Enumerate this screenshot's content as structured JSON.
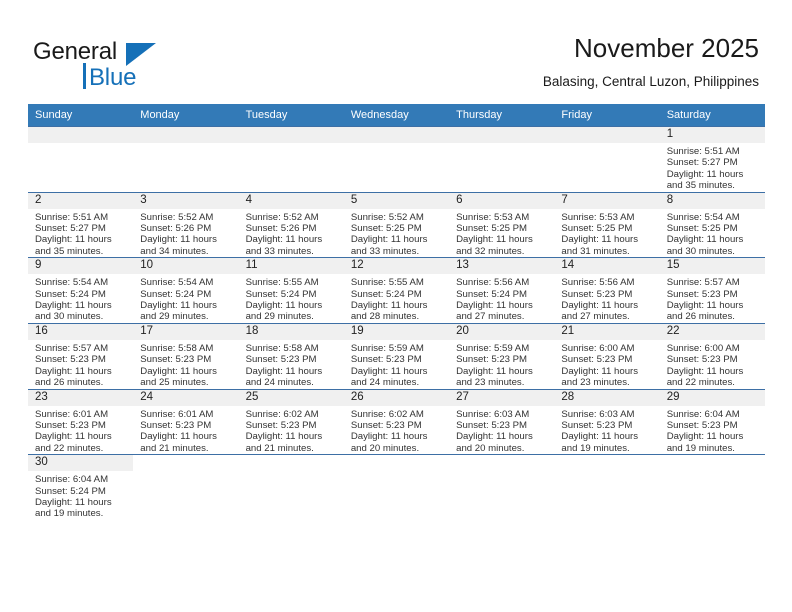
{
  "brand": {
    "name_top": "General",
    "name_bottom": "Blue",
    "accent_color": "#1570b8"
  },
  "header": {
    "title": "November 2025",
    "subtitle": "Balasing, Central Luzon, Philippines"
  },
  "calendar": {
    "header_color": "#337ab7",
    "daynum_band_color": "#f0f0f0",
    "row_border_color": "#3d6fa5",
    "weekdays": [
      "Sunday",
      "Monday",
      "Tuesday",
      "Wednesday",
      "Thursday",
      "Friday",
      "Saturday"
    ],
    "weeks": [
      [
        {
          "day": "",
          "sunrise": "",
          "sunset": "",
          "daylight": "",
          "empty": true
        },
        {
          "day": "",
          "sunrise": "",
          "sunset": "",
          "daylight": "",
          "empty": true
        },
        {
          "day": "",
          "sunrise": "",
          "sunset": "",
          "daylight": "",
          "empty": true
        },
        {
          "day": "",
          "sunrise": "",
          "sunset": "",
          "daylight": "",
          "empty": true
        },
        {
          "day": "",
          "sunrise": "",
          "sunset": "",
          "daylight": "",
          "empty": true
        },
        {
          "day": "",
          "sunrise": "",
          "sunset": "",
          "daylight": "",
          "empty": true
        },
        {
          "day": "1",
          "sunrise": "Sunrise: 5:51 AM",
          "sunset": "Sunset: 5:27 PM",
          "daylight": "Daylight: 11 hours and 35 minutes."
        }
      ],
      [
        {
          "day": "2",
          "sunrise": "Sunrise: 5:51 AM",
          "sunset": "Sunset: 5:27 PM",
          "daylight": "Daylight: 11 hours and 35 minutes."
        },
        {
          "day": "3",
          "sunrise": "Sunrise: 5:52 AM",
          "sunset": "Sunset: 5:26 PM",
          "daylight": "Daylight: 11 hours and 34 minutes."
        },
        {
          "day": "4",
          "sunrise": "Sunrise: 5:52 AM",
          "sunset": "Sunset: 5:26 PM",
          "daylight": "Daylight: 11 hours and 33 minutes."
        },
        {
          "day": "5",
          "sunrise": "Sunrise: 5:52 AM",
          "sunset": "Sunset: 5:25 PM",
          "daylight": "Daylight: 11 hours and 33 minutes."
        },
        {
          "day": "6",
          "sunrise": "Sunrise: 5:53 AM",
          "sunset": "Sunset: 5:25 PM",
          "daylight": "Daylight: 11 hours and 32 minutes."
        },
        {
          "day": "7",
          "sunrise": "Sunrise: 5:53 AM",
          "sunset": "Sunset: 5:25 PM",
          "daylight": "Daylight: 11 hours and 31 minutes."
        },
        {
          "day": "8",
          "sunrise": "Sunrise: 5:54 AM",
          "sunset": "Sunset: 5:25 PM",
          "daylight": "Daylight: 11 hours and 30 minutes."
        }
      ],
      [
        {
          "day": "9",
          "sunrise": "Sunrise: 5:54 AM",
          "sunset": "Sunset: 5:24 PM",
          "daylight": "Daylight: 11 hours and 30 minutes."
        },
        {
          "day": "10",
          "sunrise": "Sunrise: 5:54 AM",
          "sunset": "Sunset: 5:24 PM",
          "daylight": "Daylight: 11 hours and 29 minutes."
        },
        {
          "day": "11",
          "sunrise": "Sunrise: 5:55 AM",
          "sunset": "Sunset: 5:24 PM",
          "daylight": "Daylight: 11 hours and 29 minutes."
        },
        {
          "day": "12",
          "sunrise": "Sunrise: 5:55 AM",
          "sunset": "Sunset: 5:24 PM",
          "daylight": "Daylight: 11 hours and 28 minutes."
        },
        {
          "day": "13",
          "sunrise": "Sunrise: 5:56 AM",
          "sunset": "Sunset: 5:24 PM",
          "daylight": "Daylight: 11 hours and 27 minutes."
        },
        {
          "day": "14",
          "sunrise": "Sunrise: 5:56 AM",
          "sunset": "Sunset: 5:23 PM",
          "daylight": "Daylight: 11 hours and 27 minutes."
        },
        {
          "day": "15",
          "sunrise": "Sunrise: 5:57 AM",
          "sunset": "Sunset: 5:23 PM",
          "daylight": "Daylight: 11 hours and 26 minutes."
        }
      ],
      [
        {
          "day": "16",
          "sunrise": "Sunrise: 5:57 AM",
          "sunset": "Sunset: 5:23 PM",
          "daylight": "Daylight: 11 hours and 26 minutes."
        },
        {
          "day": "17",
          "sunrise": "Sunrise: 5:58 AM",
          "sunset": "Sunset: 5:23 PM",
          "daylight": "Daylight: 11 hours and 25 minutes."
        },
        {
          "day": "18",
          "sunrise": "Sunrise: 5:58 AM",
          "sunset": "Sunset: 5:23 PM",
          "daylight": "Daylight: 11 hours and 24 minutes."
        },
        {
          "day": "19",
          "sunrise": "Sunrise: 5:59 AM",
          "sunset": "Sunset: 5:23 PM",
          "daylight": "Daylight: 11 hours and 24 minutes."
        },
        {
          "day": "20",
          "sunrise": "Sunrise: 5:59 AM",
          "sunset": "Sunset: 5:23 PM",
          "daylight": "Daylight: 11 hours and 23 minutes."
        },
        {
          "day": "21",
          "sunrise": "Sunrise: 6:00 AM",
          "sunset": "Sunset: 5:23 PM",
          "daylight": "Daylight: 11 hours and 23 minutes."
        },
        {
          "day": "22",
          "sunrise": "Sunrise: 6:00 AM",
          "sunset": "Sunset: 5:23 PM",
          "daylight": "Daylight: 11 hours and 22 minutes."
        }
      ],
      [
        {
          "day": "23",
          "sunrise": "Sunrise: 6:01 AM",
          "sunset": "Sunset: 5:23 PM",
          "daylight": "Daylight: 11 hours and 22 minutes."
        },
        {
          "day": "24",
          "sunrise": "Sunrise: 6:01 AM",
          "sunset": "Sunset: 5:23 PM",
          "daylight": "Daylight: 11 hours and 21 minutes."
        },
        {
          "day": "25",
          "sunrise": "Sunrise: 6:02 AM",
          "sunset": "Sunset: 5:23 PM",
          "daylight": "Daylight: 11 hours and 21 minutes."
        },
        {
          "day": "26",
          "sunrise": "Sunrise: 6:02 AM",
          "sunset": "Sunset: 5:23 PM",
          "daylight": "Daylight: 11 hours and 20 minutes."
        },
        {
          "day": "27",
          "sunrise": "Sunrise: 6:03 AM",
          "sunset": "Sunset: 5:23 PM",
          "daylight": "Daylight: 11 hours and 20 minutes."
        },
        {
          "day": "28",
          "sunrise": "Sunrise: 6:03 AM",
          "sunset": "Sunset: 5:23 PM",
          "daylight": "Daylight: 11 hours and 19 minutes."
        },
        {
          "day": "29",
          "sunrise": "Sunrise: 6:04 AM",
          "sunset": "Sunset: 5:23 PM",
          "daylight": "Daylight: 11 hours and 19 minutes."
        }
      ],
      [
        {
          "day": "30",
          "sunrise": "Sunrise: 6:04 AM",
          "sunset": "Sunset: 5:24 PM",
          "daylight": "Daylight: 11 hours and 19 minutes."
        },
        {
          "day": "",
          "sunrise": "",
          "sunset": "",
          "daylight": "",
          "empty": true
        },
        {
          "day": "",
          "sunrise": "",
          "sunset": "",
          "daylight": "",
          "empty": true
        },
        {
          "day": "",
          "sunrise": "",
          "sunset": "",
          "daylight": "",
          "empty": true
        },
        {
          "day": "",
          "sunrise": "",
          "sunset": "",
          "daylight": "",
          "empty": true
        },
        {
          "day": "",
          "sunrise": "",
          "sunset": "",
          "daylight": "",
          "empty": true
        },
        {
          "day": "",
          "sunrise": "",
          "sunset": "",
          "daylight": "",
          "empty": true
        }
      ]
    ]
  }
}
